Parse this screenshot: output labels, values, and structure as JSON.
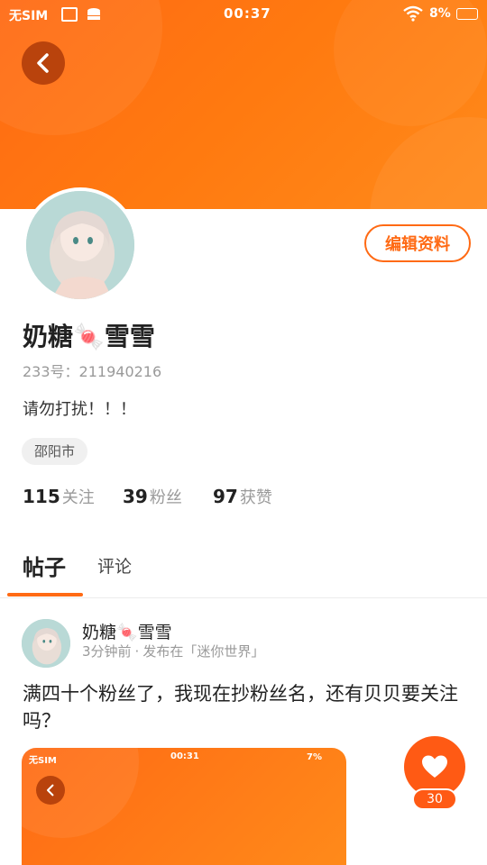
{
  "status_bar": {
    "carrier": "无SIM",
    "time": "00:37",
    "battery": "8%"
  },
  "profile": {
    "name": "奶糖🍬雪雪",
    "id_text": "233号：211940216",
    "bio": "请勿打扰！！！",
    "location": "邵阳市",
    "edit_label": "编辑资料",
    "stats": [
      {
        "value": "115",
        "label": "关注"
      },
      {
        "value": "39",
        "label": "粉丝"
      },
      {
        "value": "97",
        "label": "获赞"
      }
    ]
  },
  "tabs": [
    {
      "label": "帖子",
      "active": true
    },
    {
      "label": "评论",
      "active": false
    }
  ],
  "post": {
    "author": "奶糖🍬雪雪",
    "time": "3分钟前",
    "separator": "·",
    "forum": "发布在「迷你世界」",
    "text": "满四十个粉丝了，我现在抄粉丝名，还有贝贝要关注吗？",
    "image_status": {
      "carrier": "无SIM",
      "time": "00:31",
      "battery": "7%"
    }
  },
  "like": {
    "count": "30"
  },
  "colors": {
    "accent": "#ff6a14",
    "header_dark": "#b9430c"
  }
}
